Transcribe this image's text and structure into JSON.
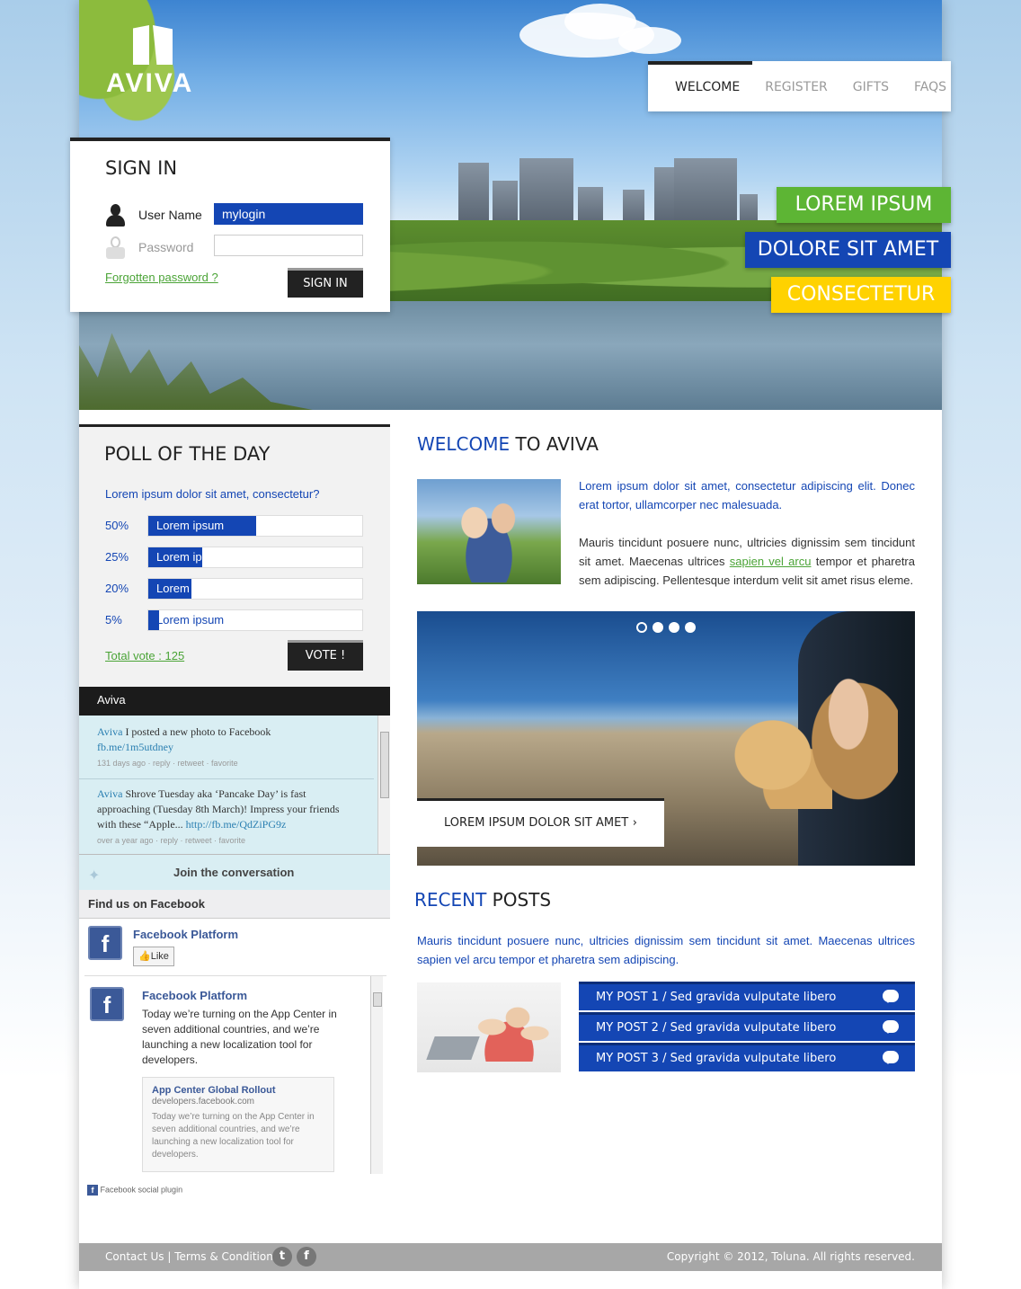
{
  "brand": {
    "name": "AVIVA"
  },
  "nav": {
    "items": [
      {
        "label": "WELCOME",
        "active": true
      },
      {
        "label": "REGISTER",
        "active": false
      },
      {
        "label": "GIFTS",
        "active": false
      },
      {
        "label": "FAQS",
        "active": false
      }
    ]
  },
  "ribbons": [
    {
      "label": "LOREM IPSUM",
      "color": "#5db534"
    },
    {
      "label": "DOLORE SIT AMET",
      "color": "#1446b4"
    },
    {
      "label": "CONSECTETUR",
      "color": "#ffd200"
    }
  ],
  "signin": {
    "title": "SIGN IN",
    "username_label": "User Name",
    "username_value": "mylogin",
    "password_label": "Password",
    "password_value": "",
    "forgot_link": "Forgotten password ?",
    "button": "SIGN IN"
  },
  "poll": {
    "title": "POLL OF THE DAY",
    "question": "Lorem ipsum dolor sit amet, consectetur?",
    "options": [
      {
        "percent_label": "50%",
        "percent": 50,
        "label": "Lorem ipsum"
      },
      {
        "percent_label": "25%",
        "percent": 25,
        "label": "Lorem ipsum dolor"
      },
      {
        "percent_label": "20%",
        "percent": 20,
        "label": "Lorem"
      },
      {
        "percent_label": "5%",
        "percent": 5,
        "label": "Lorem ipsum"
      }
    ],
    "total": "Total vote : 125",
    "button": "VOTE !"
  },
  "twitter": {
    "header": "Aviva",
    "tweets": [
      {
        "user": "Aviva",
        "text": " I posted a new photo to Facebook ",
        "link": "fb.me/1m5utdney",
        "meta": "131 days ago · reply · retweet · favorite"
      },
      {
        "user": "Aviva",
        "text": " Shrove Tuesday aka ‘Pancake Day’ is fast approaching (Tuesday 8th March)! Impress your friends with these “Apple... ",
        "link": "http://fb.me/QdZiPG9z",
        "meta": "over a year ago · reply · retweet · favorite"
      }
    ],
    "join": "Join the conversation"
  },
  "facebook": {
    "find_label": "Find us on Facebook",
    "page_name": "Facebook Platform",
    "like_button": "Like",
    "post_author": "Facebook Platform",
    "post_text": "Today we’re turning on the App Center in seven additional countries, and we’re launching a new localization tool for developers.",
    "card_title": "App Center Global Rollout",
    "card_domain": "developers.facebook.com",
    "card_text": "Today we’re turning on the App Center in seven additional countries, and we’re launching a new localization tool for developers.",
    "plugin_label": "Facebook social plugin"
  },
  "welcome": {
    "title_accent": "WELCOME",
    "title_rest": " TO AVIVA",
    "intro": "Lorem ipsum dolor sit amet, consectetur adipiscing elit. Donec erat tortor, ullamcorper nec malesuada.",
    "body_before": "Mauris tincidunt posuere nunc, ultricies dignissim sem tincidunt sit amet. Maecenas ultrices ",
    "body_link": "sapien vel arcu",
    "body_after": " tempor et pharetra sem adipiscing. Pellentesque interdum velit sit amet risus eleme."
  },
  "slider": {
    "caption": "LOREM IPSUM DOLOR SIT AMET",
    "slide_count": 4,
    "active_slide": 1
  },
  "recent": {
    "title_accent": "RECENT",
    "title_rest": " POSTS",
    "intro": "Mauris tincidunt posuere nunc, ultricies dignissim sem tincidunt sit amet. Maecenas ultrices sapien vel arcu tempor et pharetra sem adipiscing.",
    "posts": [
      {
        "label": "MY POST 1 / Sed gravida vulputate libero"
      },
      {
        "label": "MY POST 2 / Sed gravida vulputate libero"
      },
      {
        "label": "MY POST 3 / Sed gravida vulputate libero"
      }
    ]
  },
  "footer": {
    "contact": "Contact Us",
    "separator": " | ",
    "terms": "Terms & Conditions",
    "copyright": "Copyright © 2012, Toluna. All rights reserved."
  },
  "colors": {
    "brand_blue": "#1446b4",
    "green": "#4ba437",
    "dark": "#222222"
  },
  "icons": [
    "user-icon",
    "lock-icon",
    "twitter-bird-icon",
    "facebook-logo-icon",
    "comment-icon",
    "chevron-right-icon",
    "twitter-icon",
    "facebook-icon"
  ]
}
